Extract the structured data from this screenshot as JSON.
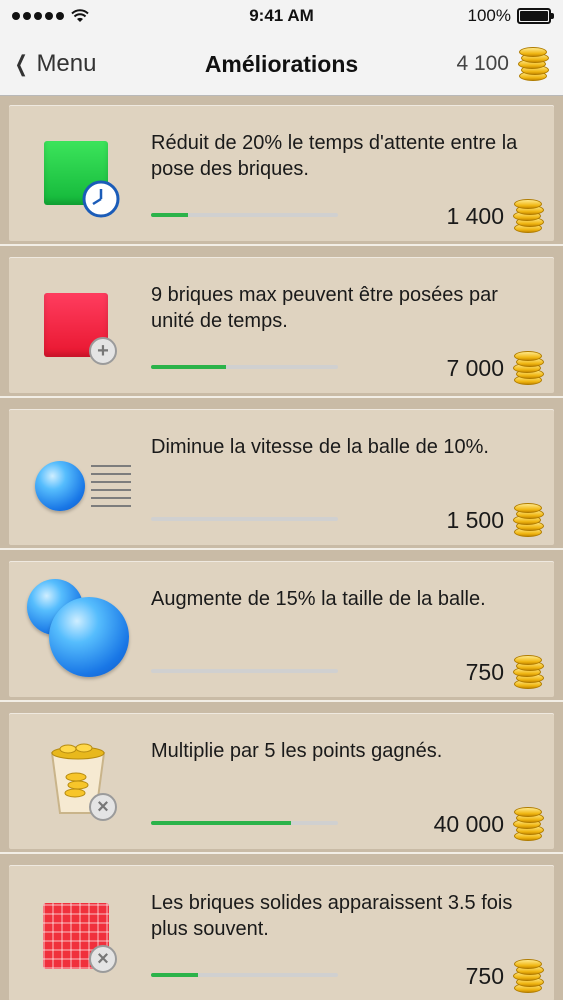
{
  "status_bar": {
    "time": "9:41 AM",
    "battery": "100%"
  },
  "nav": {
    "back_label": "Menu",
    "title": "Améliorations",
    "coins": "4 100"
  },
  "upgrades": [
    {
      "icon": "green-brick-clock-icon",
      "text": "Réduit de 20% le temps d'attente entre la pose des briques.",
      "progress": 0.2,
      "price": "1 400"
    },
    {
      "icon": "red-brick-plus-icon",
      "text": "9 briques max peuvent être posées par unité de temps.",
      "progress": 0.4,
      "price": "7 000"
    },
    {
      "icon": "slow-ball-icon",
      "text": "Diminue la vitesse de la balle de 10%.",
      "progress": 0.0,
      "price": "1 500"
    },
    {
      "icon": "big-ball-icon",
      "text": "Augmente de 15% la taille de la balle.",
      "progress": 0.0,
      "price": "750"
    },
    {
      "icon": "coin-bucket-icon",
      "text": "Multiplie par 5 les points gagnés.",
      "progress": 0.75,
      "price": "40 000"
    },
    {
      "icon": "solid-brick-icon",
      "text": "Les briques solides apparaissent 3.5 fois plus souvent.",
      "progress": 0.25,
      "price": "750"
    }
  ]
}
